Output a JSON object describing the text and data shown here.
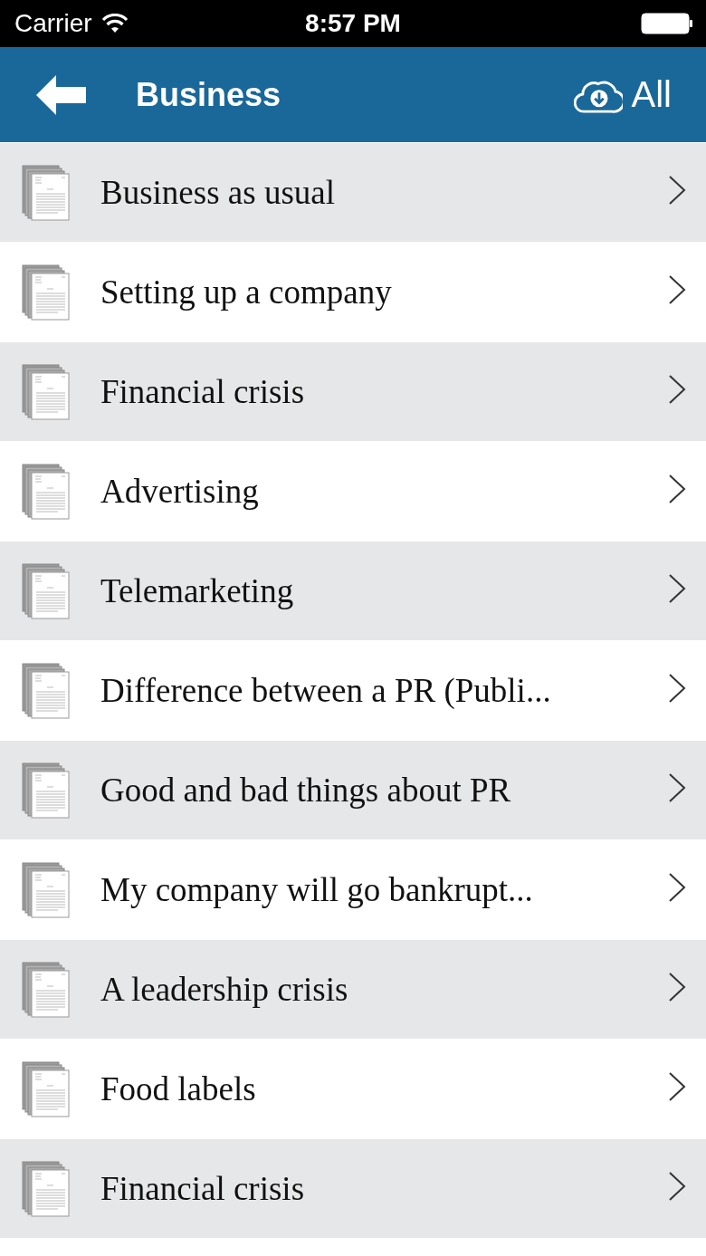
{
  "status_bar": {
    "carrier": "Carrier",
    "time": "8:57 PM"
  },
  "header": {
    "title": "Business",
    "download_label": "All"
  },
  "items": [
    {
      "title": "Business as usual"
    },
    {
      "title": "Setting up a company"
    },
    {
      "title": "Financial crisis"
    },
    {
      "title": "Advertising"
    },
    {
      "title": "Telemarketing"
    },
    {
      "title": "Difference between a PR (Publi..."
    },
    {
      "title": "Good and bad things about PR"
    },
    {
      "title": "My company will go bankrupt..."
    },
    {
      "title": "A leadership crisis"
    },
    {
      "title": "Food labels"
    },
    {
      "title": "Financial crisis"
    }
  ]
}
